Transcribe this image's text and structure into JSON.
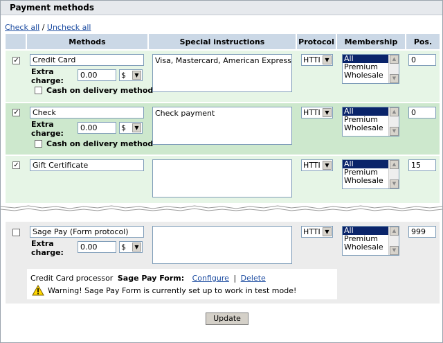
{
  "title": "Payment methods",
  "links": {
    "check_all": "Check all",
    "separator": "/",
    "uncheck_all": "Uncheck all"
  },
  "columns": {
    "methods": "Methods",
    "special": "Special instructions",
    "protocol": "Protocol",
    "membership": "Membership",
    "pos": "Pos."
  },
  "labels": {
    "extra_charge_1": "Extra",
    "extra_charge_2": "charge:",
    "cod": "Cash on delivery method"
  },
  "membership_options": [
    "All",
    "Premium",
    "Wholesale"
  ],
  "methods": [
    {
      "checked": true,
      "name": "Credit Card",
      "extra_charge": "0.00",
      "currency": "$",
      "has_cod": true,
      "cod_checked": false,
      "instructions": "Visa, Mastercard, American Express",
      "protocol": "HTTI",
      "membership_selected": "All",
      "pos": "0"
    },
    {
      "checked": true,
      "name": "Check",
      "extra_charge": "0.00",
      "currency": "$",
      "has_cod": true,
      "cod_checked": false,
      "instructions": "Check payment",
      "protocol": "HTTI",
      "membership_selected": "All",
      "pos": "0"
    },
    {
      "checked": true,
      "name": "Gift Certificate",
      "extra_charge": "",
      "currency": "",
      "has_cod": false,
      "instructions": "",
      "protocol": "HTTI",
      "membership_selected": "All",
      "pos": "15"
    },
    {
      "checked": false,
      "name": "Sage Pay (Form protocol)",
      "extra_charge": "0.00",
      "currency": "$",
      "has_cod": false,
      "instructions": "",
      "protocol": "HTTI",
      "membership_selected": "All",
      "pos": "999"
    }
  ],
  "processor": {
    "prefix": "Credit Card processor",
    "name": "Sage Pay Form:",
    "configure": "Configure",
    "sep": "|",
    "delete": "Delete",
    "warning": "Warning! Sage Pay Form is currently set up to work in test mode!"
  },
  "update_button": "Update",
  "colors": {
    "header": "#cbd8e6",
    "row_light": "#e6f5e6",
    "row_dark": "#cde8cd",
    "gray_light": "#ececec",
    "link": "#1a4aa0",
    "selected": "#0a246a"
  }
}
